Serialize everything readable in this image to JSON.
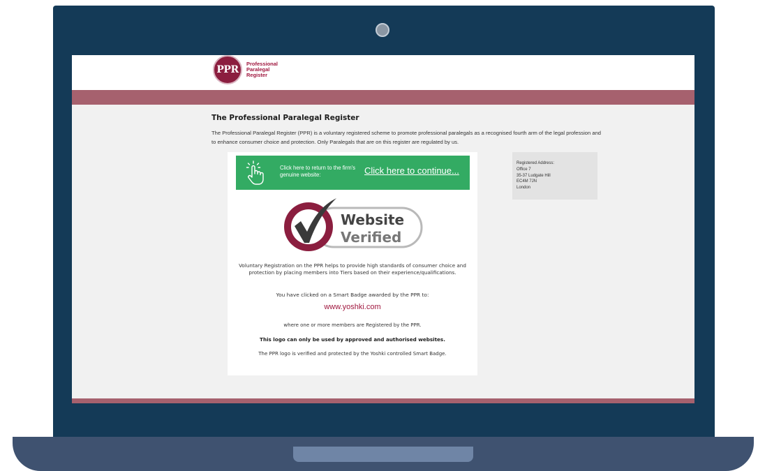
{
  "colors": {
    "lid": "#143a57",
    "base": "#3f5270",
    "band": "#a6616e",
    "brand": "#a0183f",
    "cta_green": "#33ab63"
  },
  "logo": {
    "monogram": "PPR",
    "lines": [
      "Professional",
      "Paralegal",
      "Register"
    ]
  },
  "page": {
    "title": "The Professional Paralegal Register",
    "intro": "The Professional Paralegal Register (PPR) is a voluntary registered scheme to promote professional paralegals as a recognised fourth arm of the legal profession and to enhance consumer choice and protection. Only Paralegals that are on this register are regulated by us."
  },
  "cta": {
    "icon": "pointing-hand-icon",
    "prompt": "Click here to return to the firm's genuine website:",
    "link": "Click here to continue..."
  },
  "badge": {
    "line1": "Website",
    "line2": "Verified",
    "icon": "checkmark-icon"
  },
  "card": {
    "voluntary": "Voluntary Registration on the PPR helps to provide high standards of consumer choice and protection by placing members into Tiers based on their experience/qualifications.",
    "clicked": "You have clicked on a Smart Badge awarded by the PPR to:",
    "url": "www.yoshki.com",
    "members": "where one or more members are Registered by the PPR.",
    "approved": "This logo can only be used by approved and authorised websites.",
    "verified": "The PPR logo is verified and protected by the Yoshki controlled Smart Badge."
  },
  "address": {
    "heading": "Registered Address:",
    "lines": [
      "Office 7",
      "35-37 Ludgate Hill",
      "EC4M 7JN",
      "London"
    ]
  }
}
